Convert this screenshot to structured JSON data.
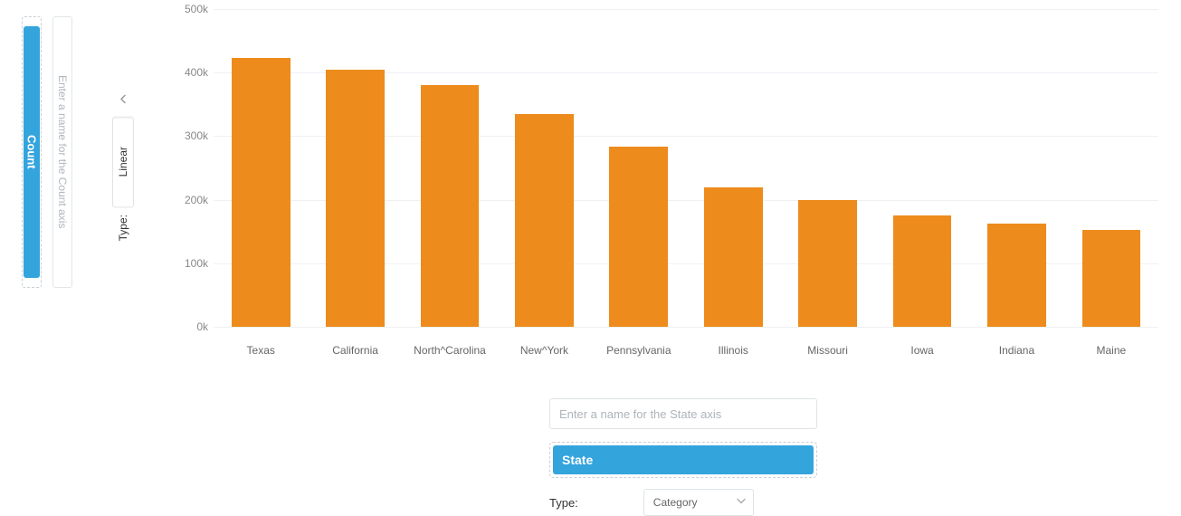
{
  "y_axis": {
    "pill_label": "Count",
    "name_placeholder": "Enter a name for the Count axis",
    "type_label": "Type:",
    "scale_selected": "Linear"
  },
  "x_axis": {
    "name_placeholder": "Enter a name for the State axis",
    "pill_label": "State",
    "type_label": "Type:",
    "type_selected": "Category"
  },
  "chart_data": {
    "type": "bar",
    "categories": [
      "Texas",
      "California",
      "North^Carolina",
      "New^York",
      "Pennsylvania",
      "Illinois",
      "Missouri",
      "Iowa",
      "Indiana",
      "Maine"
    ],
    "values": [
      423000,
      405000,
      380000,
      335000,
      283000,
      220000,
      200000,
      175000,
      162000,
      152000
    ],
    "yticks": [
      0,
      100000,
      200000,
      300000,
      400000,
      500000
    ],
    "ytick_labels": [
      "0k",
      "100k",
      "200k",
      "300k",
      "400k",
      "500k"
    ],
    "ylim": [
      0,
      500000
    ],
    "bar_color": "#ed8b1c",
    "title": "",
    "xlabel": "",
    "ylabel": ""
  }
}
